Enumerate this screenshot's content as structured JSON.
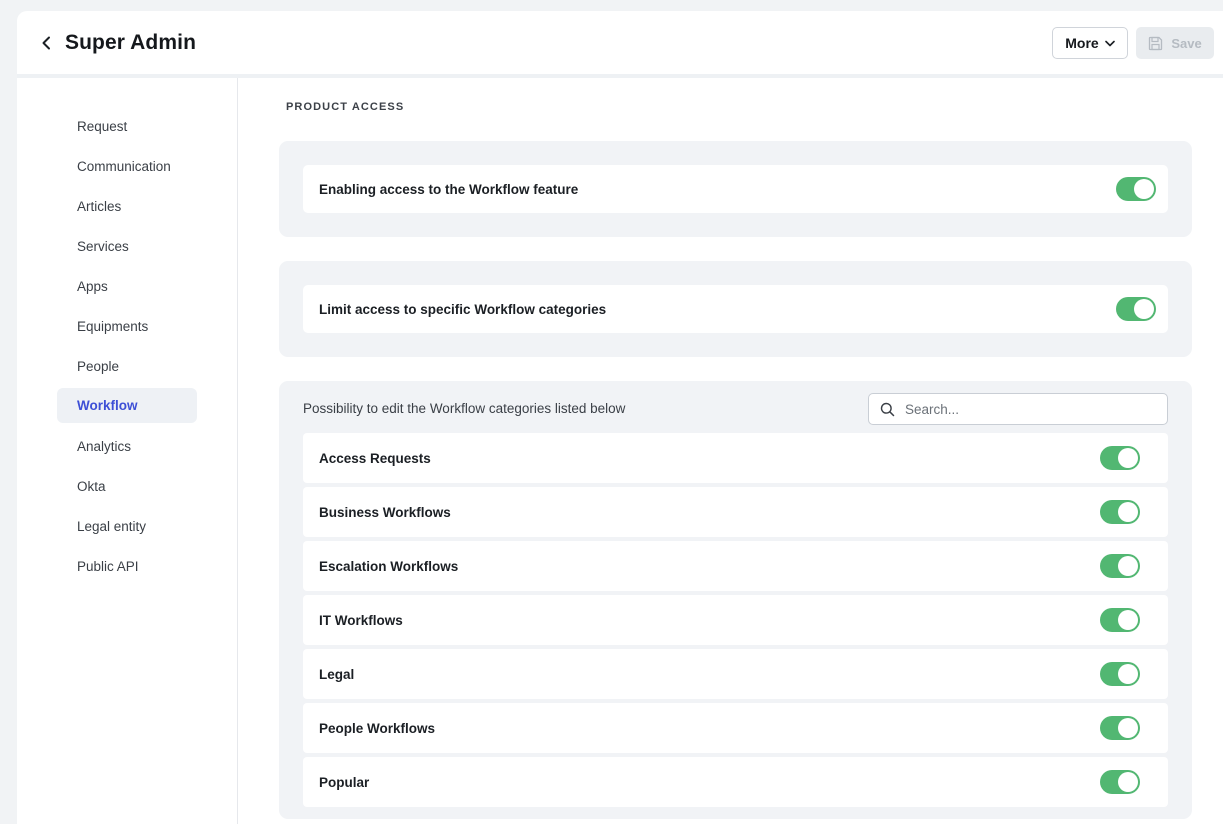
{
  "header": {
    "title": "Super Admin",
    "more_label": "More",
    "save_label": "Save"
  },
  "sidebar": {
    "items": [
      {
        "label": "Request",
        "active": false
      },
      {
        "label": "Communication",
        "active": false
      },
      {
        "label": "Articles",
        "active": false
      },
      {
        "label": "Services",
        "active": false
      },
      {
        "label": "Apps",
        "active": false
      },
      {
        "label": "Equipments",
        "active": false
      },
      {
        "label": "People",
        "active": false
      },
      {
        "label": "Workflow",
        "active": true
      },
      {
        "label": "Analytics",
        "active": false
      },
      {
        "label": "Okta",
        "active": false
      },
      {
        "label": "Legal entity",
        "active": false
      },
      {
        "label": "Public API",
        "active": false
      }
    ]
  },
  "main": {
    "section_title": "PRODUCT ACCESS",
    "settings": [
      {
        "label": "Enabling access to the Workflow feature",
        "enabled": true
      },
      {
        "label": "Limit access to specific Workflow categories",
        "enabled": true
      }
    ],
    "categories": {
      "caption": "Possibility to edit the Workflow categories listed below",
      "search_placeholder": "Search...",
      "items": [
        {
          "label": "Access Requests",
          "enabled": true
        },
        {
          "label": "Business Workflows",
          "enabled": true
        },
        {
          "label": "Escalation Workflows",
          "enabled": true
        },
        {
          "label": "IT Workflows",
          "enabled": true
        },
        {
          "label": "Legal",
          "enabled": true
        },
        {
          "label": "People Workflows",
          "enabled": true
        },
        {
          "label": "Popular",
          "enabled": true
        }
      ]
    }
  },
  "colors": {
    "toggle_on": "#52b772",
    "active_nav_text": "#3d4fd6",
    "panel_bg": "#f1f3f6"
  }
}
